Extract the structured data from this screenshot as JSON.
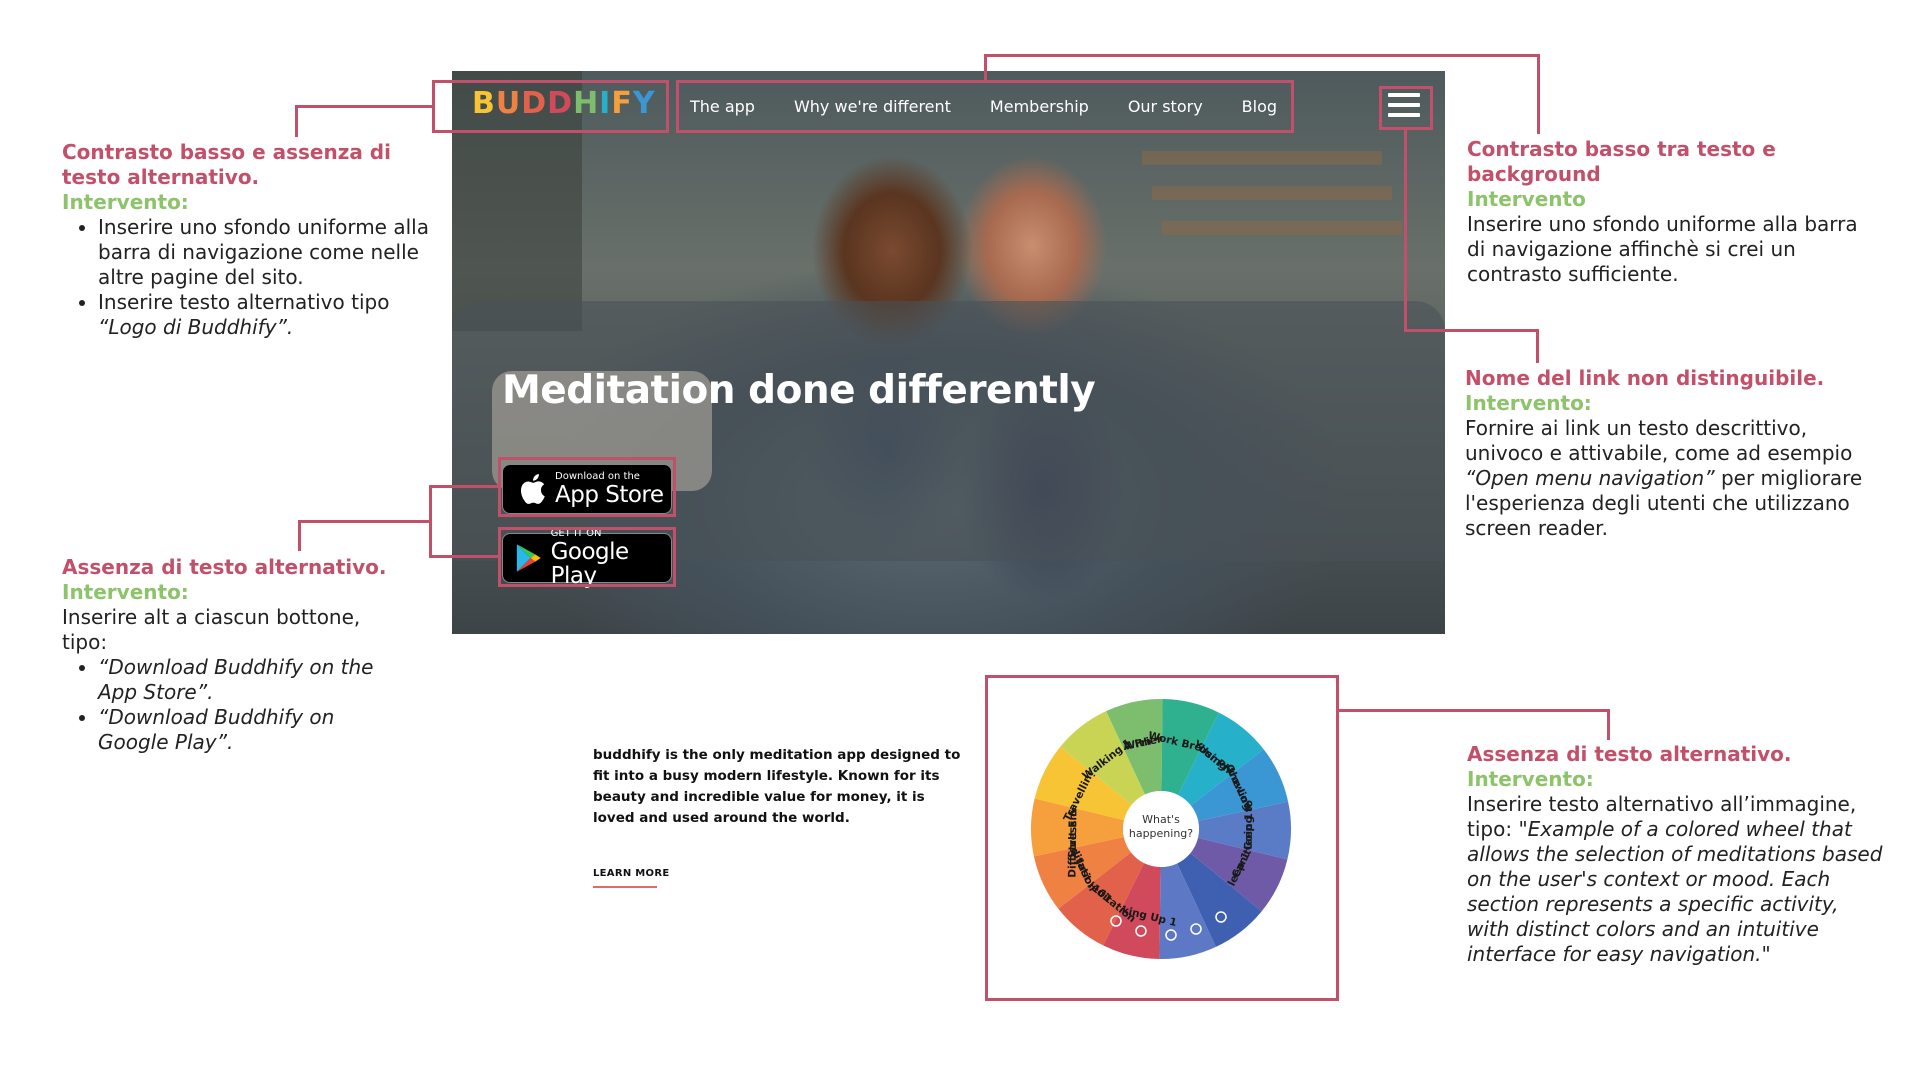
{
  "hero": {
    "logo_text": "BUDDHIFY",
    "nav": [
      {
        "label": "The app"
      },
      {
        "label": "Why we're different"
      },
      {
        "label": "Membership"
      },
      {
        "label": "Our story"
      },
      {
        "label": "Blog"
      }
    ],
    "title": "Meditation done differently",
    "app_store": {
      "small": "Download on the",
      "big": "App Store"
    },
    "google_play": {
      "small": "GET IT ON",
      "big": "Google Play"
    }
  },
  "content": {
    "description": "buddhify is the only meditation app designed to fit into a busy modern lifestyle. Known for its beauty and incredible value for money, it is loved and used around the world.",
    "learn_more": "LEARN MORE"
  },
  "wheel": {
    "center_line1": "What's",
    "center_line2": "happening?",
    "segments": [
      {
        "label1": "With",
        "label2": "A Friend",
        "color": "#7dbd6e"
      },
      {
        "label1": "Work Break",
        "label2": "",
        "color": "#2fb18f"
      },
      {
        "label1": "Using",
        "label2": "Your Phone",
        "color": "#27b0c9"
      },
      {
        "label1": "Growing",
        "label2": "the Lovely",
        "color": "#3a97d3"
      },
      {
        "label1": "Going to",
        "label2": "Sleep 1",
        "color": "#5a7cc6"
      },
      {
        "label1": "Can't",
        "label2": "Sleep 1",
        "color": "#6f5aa8"
      },
      {
        "label1": "",
        "label2": "",
        "color": "#3f5fb0"
      },
      {
        "label1": "",
        "label2": "",
        "color": "#5d78c4"
      },
      {
        "label1": "Waking Up 1",
        "label2": "",
        "color": "#d14a5c"
      },
      {
        "label1": "Meditation",
        "label2": "101",
        "color": "#e2614a"
      },
      {
        "label1": "Just",
        "label2": "Meditation",
        "color": "#ef8142"
      },
      {
        "label1": "Stress &",
        "label2": "Difficult Emotion 1",
        "color": "#f59f3d"
      },
      {
        "label1": "Travelling 1",
        "label2": "",
        "color": "#f7c436"
      },
      {
        "label1": "Walking 1",
        "label2": "",
        "color": "#c9d454"
      }
    ]
  },
  "annotations": {
    "logo": {
      "title": "Contrasto basso e assenza di testo alternativo.",
      "label": "Intervento:",
      "items": [
        "Inserire uno sfondo uniforme alla barra di navigazione come nelle altre pagine del sito.",
        "Inserire testo alternativo tipo"
      ],
      "item2_italic": "“Logo di Buddhify”."
    },
    "nav": {
      "title": "Contrasto basso tra testo e background",
      "label": "Intervento",
      "text": "Inserire uno sfondo uniforme alla barra di navigazione affinchè si crei un contrasto sufficiente."
    },
    "menu": {
      "title": "Nome del link non distinguibile.",
      "label": "Intervento:",
      "text_before": "Fornire ai link un testo descrittivo, univoco e attivabile, come ad esempio",
      "text_italic": "“Open menu navigation”",
      "text_after": "per migliorare l'esperienza degli utenti che utilizzano screen reader."
    },
    "buttons": {
      "title": "Assenza di testo alternativo.",
      "label": "Intervento:",
      "text": "Inserire alt a ciascun bottone, tipo:",
      "items": [
        "“Download Buddhify on the App Store”.",
        "“Download Buddhify on Google Play”."
      ]
    },
    "wheel": {
      "title": "Assenza di testo alternativo.",
      "label": "Intervento:",
      "text": "Inserire testo alternativo all’immagine, tipo:",
      "italic": "\"Example of a colored wheel that allows the selection of meditations based on the user's context or mood. Each section represents a specific activity, with distinct colors and an intuitive interface for easy navigation.\""
    }
  },
  "colors": {
    "annotation_red": "#c3506a",
    "annotation_green": "#8dc36a",
    "learn_underline": "#e06a6a"
  }
}
